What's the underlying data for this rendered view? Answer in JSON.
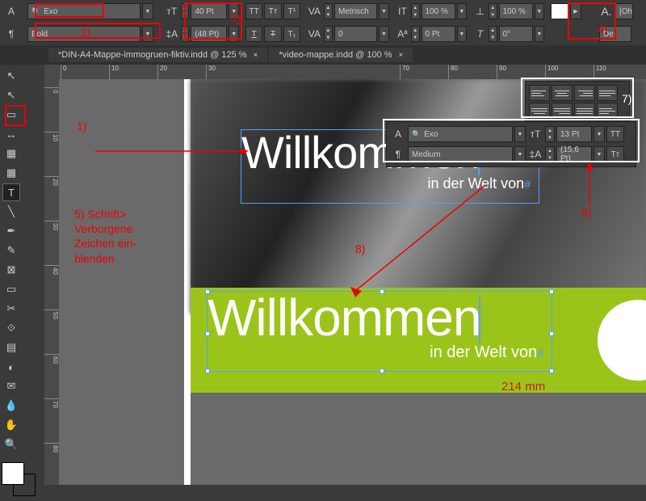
{
  "topbar": {
    "font_family": "Exo",
    "font_style": "Bold",
    "font_size": "40 Pt",
    "leading": "(48 Pt)",
    "kerning": "Metrisch",
    "tracking": "0",
    "vscale": "100 %",
    "hscale": "100 %",
    "baseline": "0 Pt",
    "skew": "0°",
    "lang_fragment": "[Oh",
    "de_fragment": "De"
  },
  "tabs": [
    {
      "title": "*DIN-A4-Mappe-immogruen-fiktiv.indd @ 125 %"
    },
    {
      "title": "*video-mappe.indd @ 100 %"
    }
  ],
  "ruler_h": [
    "0",
    "10",
    "20",
    "30",
    "70",
    "80",
    "90",
    "100",
    "110"
  ],
  "ruler_v": [
    "0",
    "10",
    "20",
    "30",
    "40",
    "50",
    "60",
    "70",
    "80"
  ],
  "text1": {
    "headline": "Willkommen",
    "sub": "in der Welt von"
  },
  "text2": {
    "headline": "Willkommen",
    "sub": "in der Welt von"
  },
  "mini": {
    "font_family": "Exo",
    "font_style": "Medium",
    "font_size": "13 Pt",
    "leading": "(15,6 Pt)"
  },
  "annotations": {
    "a1": "1)",
    "a2": "2)",
    "a3": "3)",
    "a4": "4)",
    "a5": "5) Schrift> Verborgene Zeichen ein-blenden",
    "a6": "6)",
    "a7": "7)",
    "a8": "8)"
  },
  "dimension": "214 mm"
}
